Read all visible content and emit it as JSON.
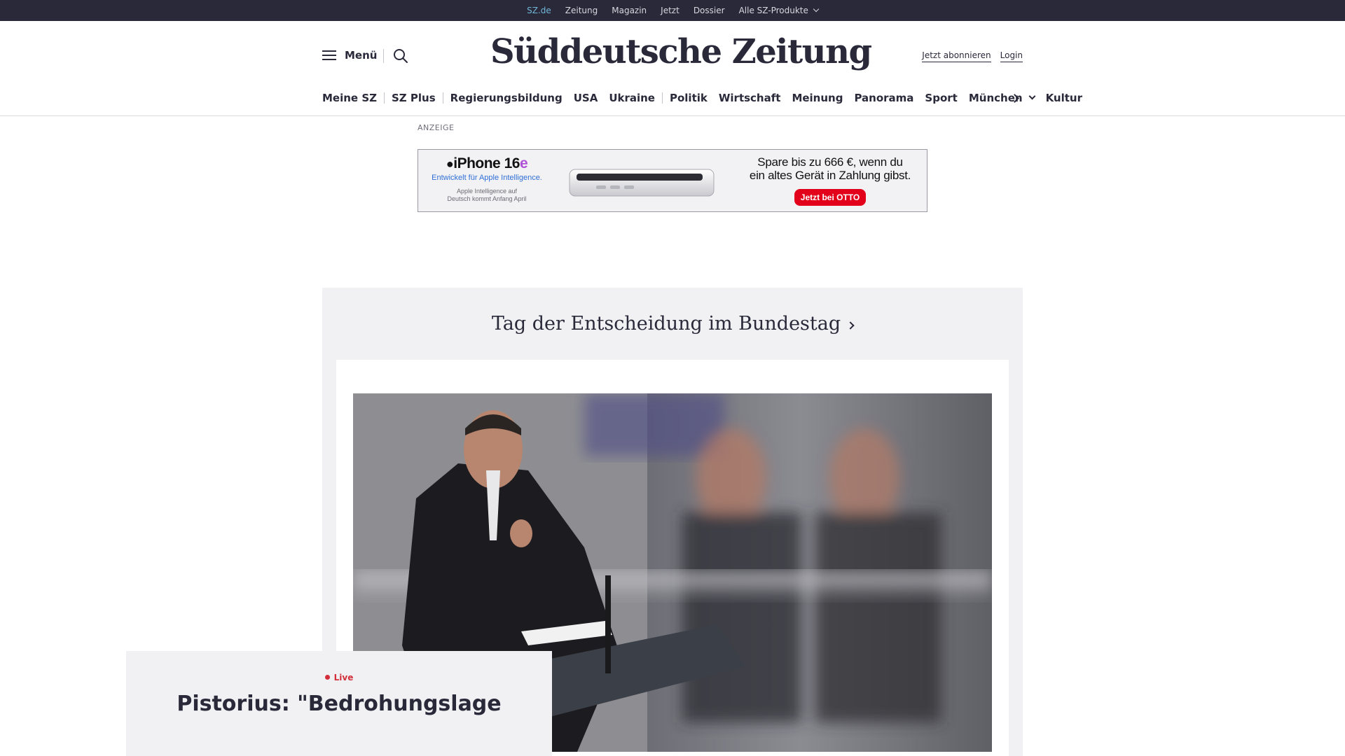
{
  "topbar": {
    "links": [
      "SZ.de",
      "Zeitung",
      "Magazin",
      "Jetzt",
      "Dossier",
      "Alle SZ-Produkte"
    ],
    "accent_color": "#71b5d6",
    "background": "#29293a"
  },
  "header": {
    "menu_label": "Menü",
    "logo_text": "Süddeutsche Zeitung",
    "subscribe_label": "Jetzt abonnieren",
    "login_label": "Login"
  },
  "nav": {
    "items": [
      "Meine SZ",
      "SZ Plus",
      "Regierungsbildung",
      "USA",
      "Ukraine",
      "Politik",
      "Wirtschaft",
      "Meinung",
      "Panorama",
      "Sport",
      "München",
      "Kultur"
    ]
  },
  "ad": {
    "label": "ANZEIGE",
    "brand": "iPhone 16",
    "brand_suffix": "e",
    "tagline": "Entwickelt für Apple Intelligence.",
    "note_line1": "Apple Intelligence auf",
    "note_line2": "Deutsch kommt Anfang April",
    "claim_line1": "Spare bis zu 666 €, wenn du",
    "claim_line2": "ein altes Gerät in Zahlung gibst.",
    "cta": "Jetzt bei OTTO",
    "cta_color": "#e2001a"
  },
  "teaser": {
    "section_title": "Tag der Entscheidung im Bundestag",
    "live_label": "Live",
    "live_color": "#d32f3a",
    "headline": "Pistorius: \"Bedrohungslage"
  }
}
